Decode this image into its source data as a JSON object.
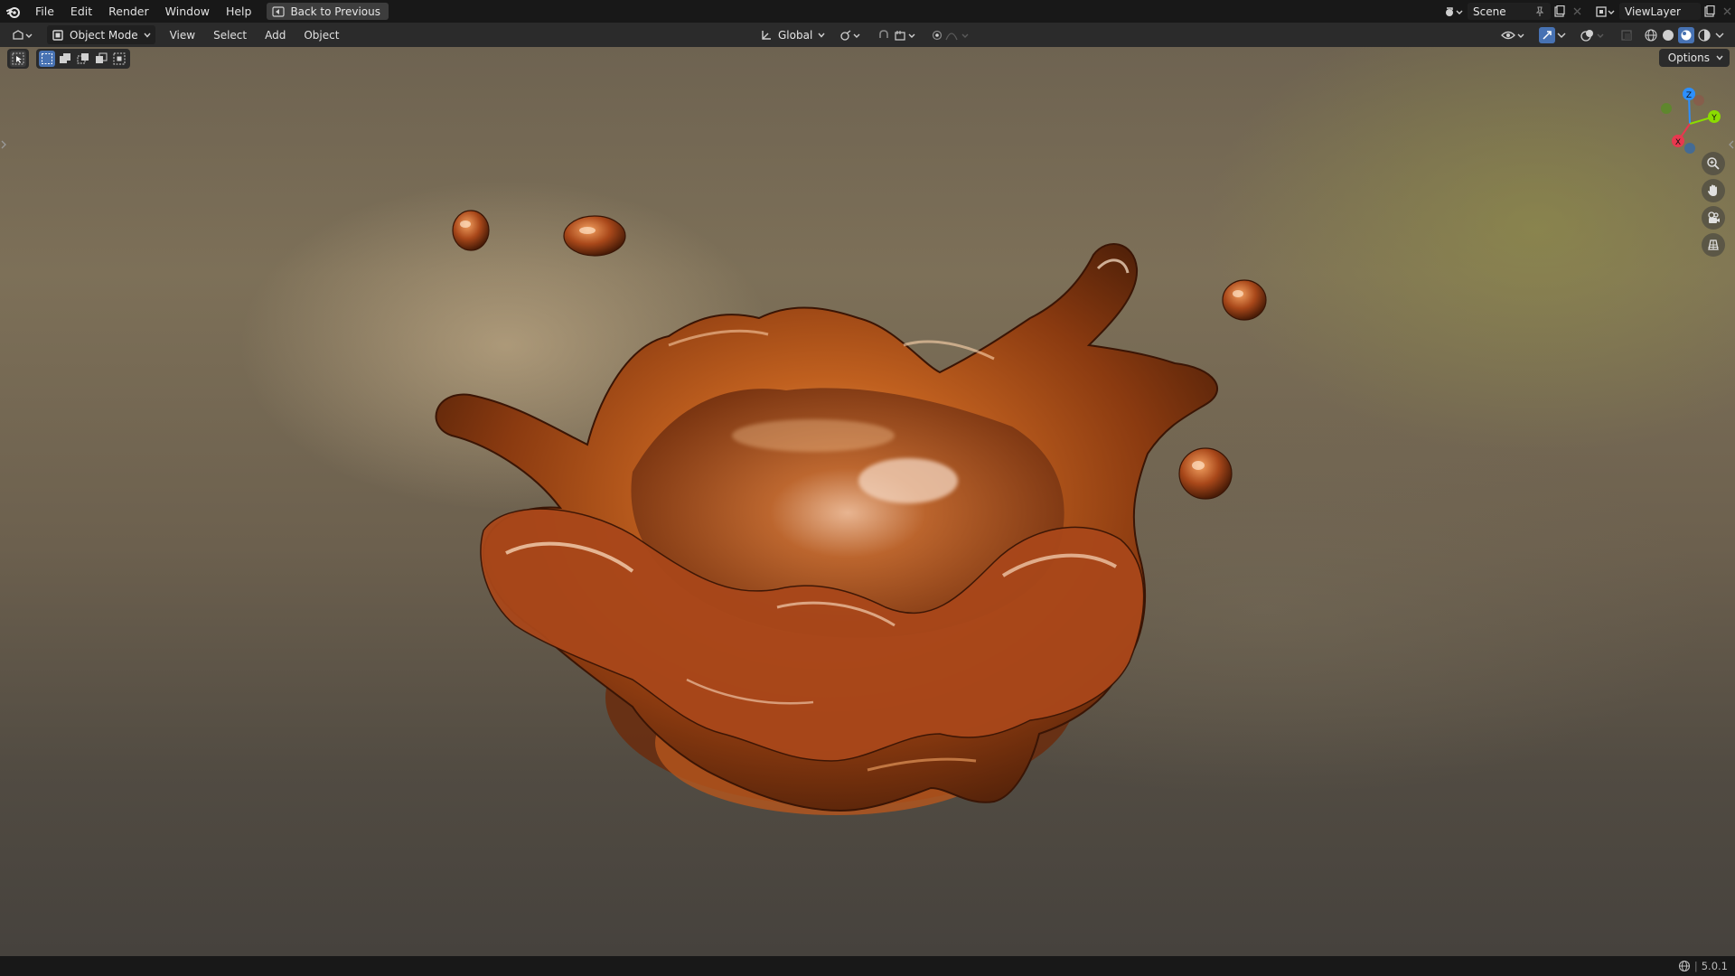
{
  "menu": {
    "items": [
      {
        "id": "file",
        "label": "File"
      },
      {
        "id": "edit",
        "label": "Edit"
      },
      {
        "id": "render",
        "label": "Render"
      },
      {
        "id": "window",
        "label": "Window"
      },
      {
        "id": "help",
        "label": "Help"
      }
    ],
    "back_label": "Back to Previous"
  },
  "scene": {
    "name": "Scene"
  },
  "view_layer": {
    "name": "ViewLayer"
  },
  "viewport_header": {
    "mode": "Object Mode",
    "menus": [
      "View",
      "Select",
      "Add",
      "Object"
    ],
    "orientation": "Global"
  },
  "options": {
    "label": "Options"
  },
  "gizmo": {
    "x": "X",
    "y": "Y",
    "z": "Z"
  },
  "status": {
    "version": "5.0.1"
  },
  "colors": {
    "accent": "#4772b3",
    "object": "#b5561c",
    "axis_x": "#e8384f",
    "axis_y": "#8bdc00",
    "axis_z": "#2c8fff"
  },
  "icons": [
    "blender-logo-icon",
    "back-icon",
    "editor-type-icon",
    "object-mode-icon",
    "orientation-icon",
    "pivot-icon",
    "snap-icon",
    "proportional-icon",
    "overlay-icon",
    "gizmo-icon",
    "xray-icon",
    "wireframe-icon",
    "solid-icon",
    "material-icon",
    "rendered-icon",
    "zoom-icon",
    "hand-icon",
    "camera-icon",
    "grid-icon",
    "pin-icon",
    "new-icon",
    "close-icon",
    "network-icon"
  ]
}
